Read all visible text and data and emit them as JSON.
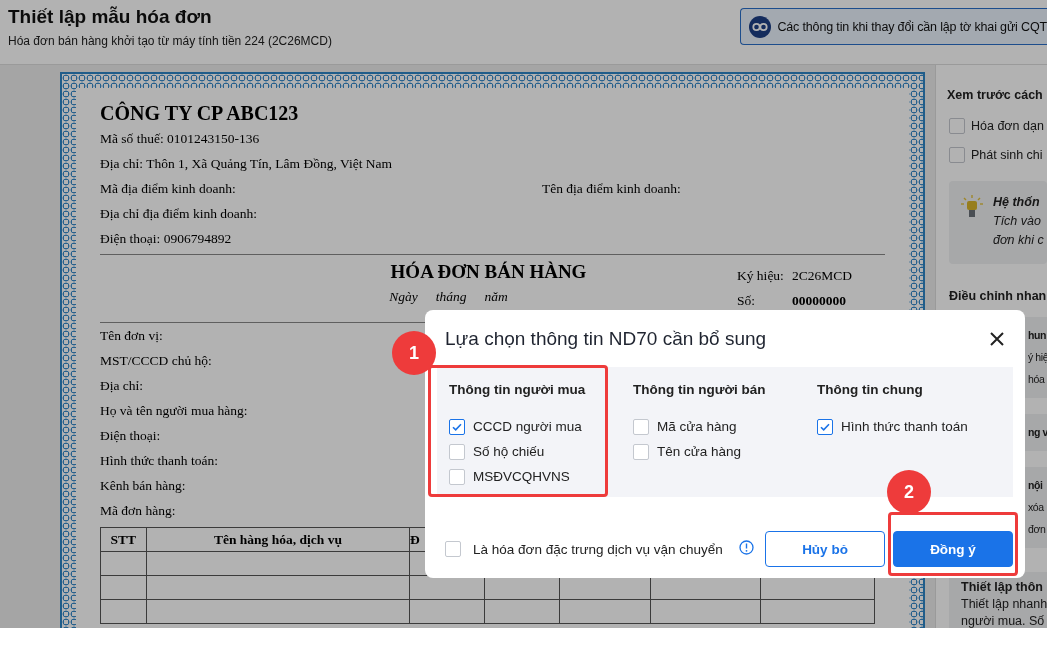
{
  "header": {
    "title": "Thiết lập mẫu hóa đơn",
    "subtitle": "Hóa đơn bán hàng khởi tạo từ máy tính tiền 224 (2C26MCD)",
    "notice_button": "Các thông tin khi thay đổi cần lập tờ khai gửi CQT"
  },
  "invoice": {
    "company": "CÔNG TY CP ABC123",
    "seller_lines": [
      [
        "Mã số thuế: 0101243150-136"
      ],
      [
        "Địa chỉ: Thôn 1, Xã Quảng Tín, Lâm Đồng, Việt Nam"
      ],
      [
        "Mã địa điểm kinh doanh:",
        "Tên địa điểm kinh doanh:"
      ],
      [
        "Địa chỉ địa điểm kinh doanh:"
      ],
      [
        "Điện thoại: 0906794892"
      ]
    ],
    "title": "HÓA ĐƠN BÁN HÀNG",
    "date_parts": [
      "Ngày",
      "tháng",
      "năm"
    ],
    "symbol_label": "Ký hiệu:",
    "symbol": "2C26MCD",
    "number_label": "Số:",
    "number": "00000000",
    "buyer_lines": [
      "Tên đơn vị:",
      "MST/CCCD chủ hộ:",
      "Địa chỉ:",
      "Họ và tên người mua hàng:",
      "Điện thoại:",
      "Hình thức thanh toán:",
      "Kênh bán hàng:",
      "Mã đơn hàng:"
    ],
    "table": {
      "columns": [
        "STT",
        "Tên hàng hóa, dịch vụ",
        "Đ"
      ]
    }
  },
  "side_panel": {
    "preview_title": "Xem trước cách",
    "options": [
      {
        "label": "Hóa đơn dạn",
        "checked": false
      },
      {
        "label": "Phát sinh chi",
        "checked": false
      }
    ],
    "tip": {
      "title": "Hệ thốn",
      "lines": [
        "Tích vào",
        "đơn khi c"
      ]
    },
    "adjust_title": "Điều chỉnh nhan",
    "covered_cards": [
      {
        "title": "hun",
        "lines": [
          "ý hiệ",
          "hóa"
        ]
      },
      {
        "title": "ng v"
      },
      {
        "title": "nội",
        "lines": [
          "xóa",
          "đơn"
        ]
      }
    ],
    "cards": [
      {
        "title": "Thiết lập thôn",
        "lines": [
          "Thiết lập nhanh",
          "người mua. Số"
        ]
      }
    ]
  },
  "dialog": {
    "title": "Lựa chọn thông tin ND70 cần bổ sung",
    "groups": [
      {
        "title": "Thông tin người mua",
        "options": [
          {
            "label": "CCCD người mua",
            "checked": true
          },
          {
            "label": "Số hộ chiếu",
            "checked": false
          },
          {
            "label": "MSĐVCQHVNS",
            "checked": false
          }
        ]
      },
      {
        "title": "Thông tin người bán",
        "options": [
          {
            "label": "Mã cửa hàng",
            "checked": false
          },
          {
            "label": "Tên cửa hàng",
            "checked": false
          }
        ]
      },
      {
        "title": "Thông tin chung",
        "options": [
          {
            "label": "Hình thức thanh toán",
            "checked": true
          }
        ]
      }
    ],
    "transport_option": {
      "label": "Là hóa đơn đặc trưng dịch vụ vận chuyển",
      "checked": false
    },
    "buttons": [
      {
        "label": "Hủy bỏ",
        "kind": "secondary"
      },
      {
        "label": "Đồng ý",
        "kind": "primary"
      }
    ]
  },
  "annotations": [
    {
      "label": "1",
      "kind": "group"
    },
    {
      "label": "2",
      "kind": "button"
    }
  ]
}
